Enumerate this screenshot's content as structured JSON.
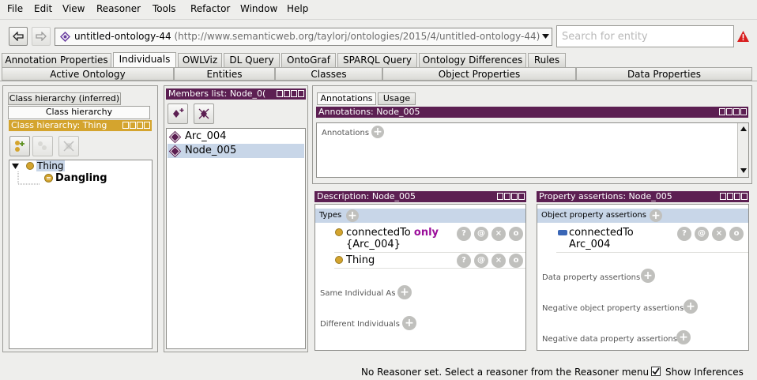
{
  "menu": [
    "File",
    "Edit",
    "View",
    "Reasoner",
    "Tools",
    "Refactor",
    "Window",
    "Help"
  ],
  "toolbar": {
    "ontology_name": "untitled-ontology-44",
    "ontology_url": "(http://www.semanticweb.org/taylorj/ontologies/2015/4/untitled-ontology-44)",
    "search_placeholder": "Search for entity"
  },
  "tabs": [
    "Annotation Properties",
    "Individuals",
    "OWLViz",
    "DL Query",
    "OntoGraf",
    "SPARQL Query",
    "Ontology Differences",
    "Rules"
  ],
  "subtabs": [
    "Active Ontology",
    "Entities",
    "Classes",
    "Object Properties",
    "Data Properties"
  ],
  "class_panel": {
    "tab_inferred": "Class hierarchy (inferred)",
    "tab_asserted": "Class hierarchy",
    "title": "Class hierarchy: Thing",
    "tree": [
      {
        "label": "Thing",
        "children": [
          {
            "label": "Dangling"
          }
        ]
      }
    ]
  },
  "members": {
    "title": "Members list: Node_0(",
    "items": [
      "Arc_004",
      "Node_005"
    ]
  },
  "annotations_panel": {
    "tab_annotations": "Annotations",
    "tab_usage": "Usage",
    "title": "Annotations: Node_005",
    "label": "Annotations"
  },
  "description": {
    "title": "Description: Node_005",
    "types_label": "Types",
    "types": [
      {
        "prop": "connectedTo",
        "keyword": "only",
        "filler": "{Arc_004}"
      },
      {
        "prop": "Thing"
      }
    ],
    "same_label": "Same Individual As",
    "different_label": "Different Individuals"
  },
  "property_assertions": {
    "title": "Property assertions: Node_005",
    "object_label": "Object property assertions",
    "object_items": [
      {
        "prop": "connectedTo",
        "value": "Arc_004"
      }
    ],
    "data_label": "Data property assertions",
    "neg_object_label": "Negative object property assertions",
    "neg_data_label": "Negative data property assertions"
  },
  "axiom_buttons": [
    "?",
    "@",
    "×",
    "o"
  ],
  "status": {
    "message": "No Reasoner set. Select a reasoner from the Reasoner menu",
    "show_inferences": "Show Inferences"
  },
  "colors": {
    "header_purple": "#5c1f52",
    "header_gold": "#d4a42e",
    "selection": "#c8d6e8",
    "keyword": "#9b0e9b"
  }
}
